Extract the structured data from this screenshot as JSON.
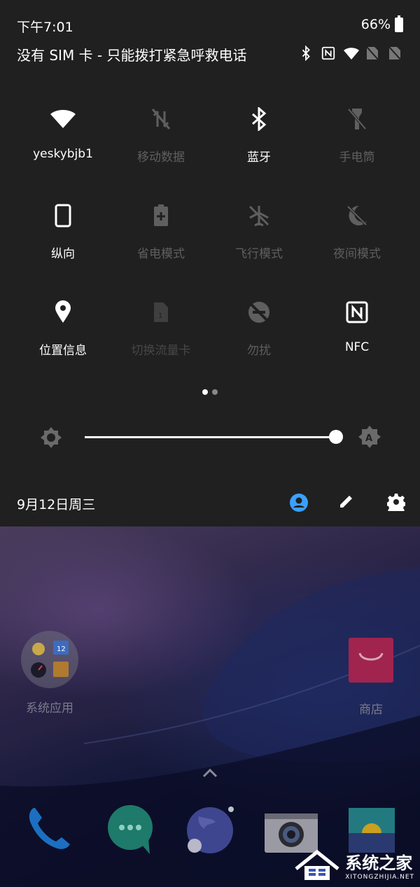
{
  "status_bar": {
    "time": "下午7:01",
    "battery_percent": "66%",
    "carrier_text": "没有 SIM 卡 - 只能拨打紧急呼救电话",
    "carrier_icons": [
      "bluetooth-icon",
      "nfc-icon",
      "wifi-icon",
      "no-sim-icon",
      "no-sim-icon"
    ]
  },
  "quick_settings": {
    "tiles": [
      {
        "label": "yeskybjb1",
        "icon": "wifi-icon",
        "active": true
      },
      {
        "label": "移动数据",
        "icon": "mobile-data-off-icon",
        "active": false
      },
      {
        "label": "蓝牙",
        "icon": "bluetooth-icon",
        "active": true
      },
      {
        "label": "手电筒",
        "icon": "flashlight-off-icon",
        "active": false
      },
      {
        "label": "纵向",
        "icon": "portrait-icon",
        "active": true
      },
      {
        "label": "省电模式",
        "icon": "battery-saver-icon",
        "active": false
      },
      {
        "label": "飞行模式",
        "icon": "airplane-off-icon",
        "active": false
      },
      {
        "label": "夜间模式",
        "icon": "night-mode-off-icon",
        "active": false
      },
      {
        "label": "位置信息",
        "icon": "location-icon",
        "active": true
      },
      {
        "label": "切换流量卡",
        "icon": "sim-switch-icon",
        "active": false
      },
      {
        "label": "勿扰",
        "icon": "do-not-disturb-off-icon",
        "active": false
      },
      {
        "label": "NFC",
        "icon": "nfc-icon",
        "active": true
      }
    ],
    "page_count": 2,
    "current_page": 1,
    "brightness_level": 1.0
  },
  "footer": {
    "date": "9月12日周三",
    "icons": [
      "user-icon",
      "edit-icon",
      "settings-icon"
    ]
  },
  "home": {
    "folder_label": "系统应用",
    "folder_badge": "12",
    "store_label": "商店",
    "dock": [
      "phone-app",
      "messages-app",
      "browser-app",
      "camera-app",
      "gallery-app"
    ]
  },
  "watermark": {
    "title": "系统之家",
    "subtitle": "XITONGZHIJIA.NET"
  },
  "colors": {
    "panel_bg": "#202020",
    "active_icon": "#ffffff",
    "inactive_icon": "#5f5f5f",
    "accent_user": "#3aa0ff",
    "store_red": "#a0244e"
  }
}
